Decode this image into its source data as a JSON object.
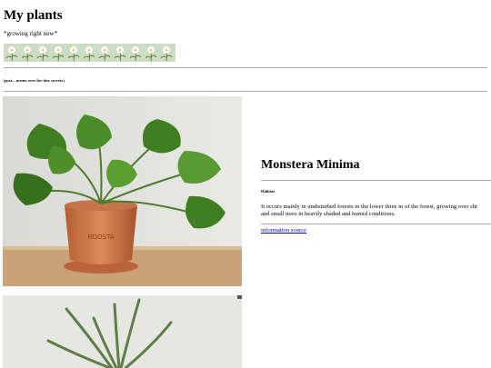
{
  "header": {
    "title": "My plants",
    "subtitle": "*growing right now*",
    "note": "(psst... msmo over for tiny secrets)"
  },
  "banner": {
    "icon": "daisy-flower-icon",
    "background": "#cfdcc5",
    "repeat": 11
  },
  "plants": [
    {
      "image": "monstera-minima-photo",
      "name": "Monstera Minima",
      "habitat_label": "Habitat",
      "habitat_text_line1": "It occurs mainly in undisturbed forests in the lower three m of the forest, growing over shr",
      "habitat_text_line2": "and small trees in heavily shaded and humid conditions.",
      "link_text": "information source"
    },
    {
      "image": "aloe-plant-photo"
    }
  ],
  "pot_text": "ROOSTA"
}
